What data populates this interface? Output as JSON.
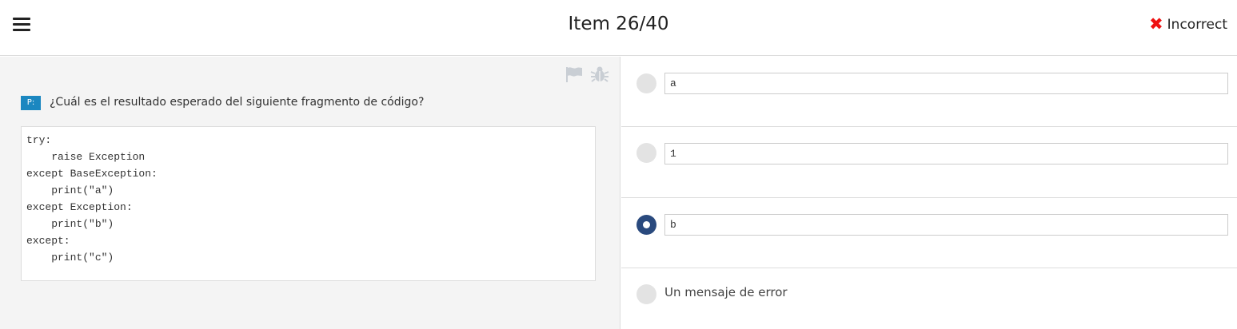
{
  "header": {
    "title": "Item 26/40",
    "status_label": "Incorrect",
    "status_icon": "x-mark-icon",
    "status_color": "#ee1111"
  },
  "question": {
    "badge": "P:",
    "badge_color": "#1b87c0",
    "text": "¿Cuál es el resultado esperado del siguiente fragmento de código?",
    "tools": [
      "flag-icon",
      "bug-icon"
    ],
    "code": "try:\n    raise Exception\nexcept BaseException:\n    print(\"a\")\nexcept Exception:\n    print(\"b\")\nexcept:\n    print(\"c\")"
  },
  "answers": {
    "selected_index": 2,
    "selected_color": "#2a4a7e",
    "options": [
      {
        "label": "a"
      },
      {
        "label": "1"
      },
      {
        "label": "b"
      },
      {
        "label": "Un mensaje de error"
      }
    ]
  }
}
